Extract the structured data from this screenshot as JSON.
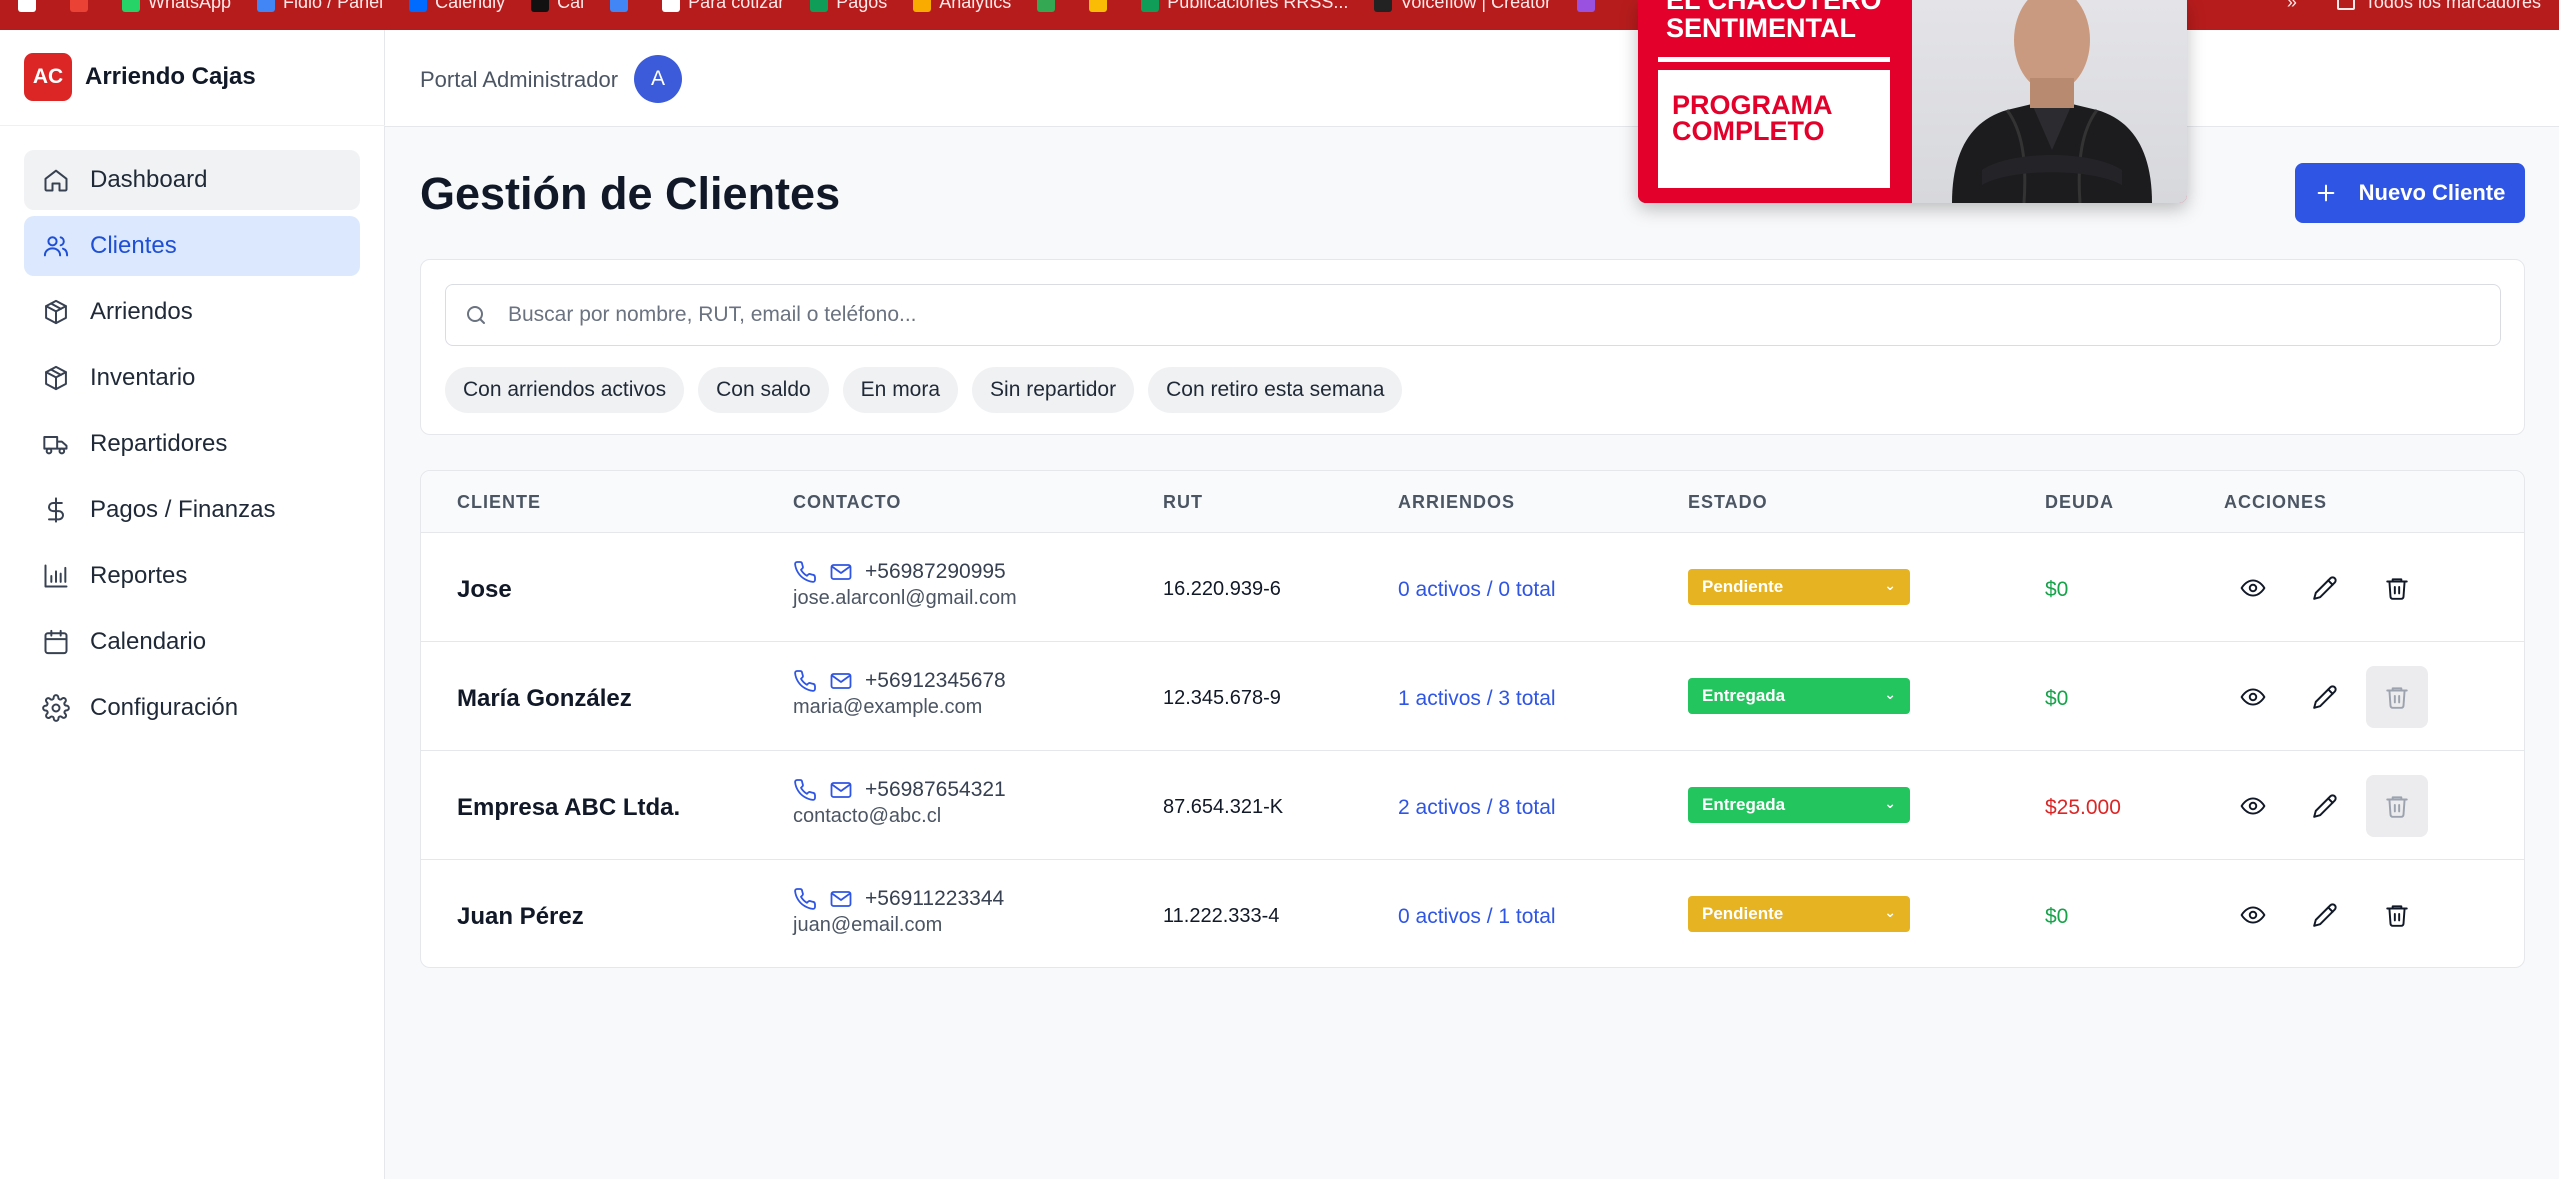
{
  "bookmarks": {
    "items": [
      {
        "label": "",
        "color": "#ffffff"
      },
      {
        "label": "",
        "color": "#ea4335"
      },
      {
        "label": "WhatsApp",
        "color": "#25d366"
      },
      {
        "label": "Fidio / Panel",
        "color": "#4285f4"
      },
      {
        "label": "Calendly",
        "color": "#006bff"
      },
      {
        "label": "Cal",
        "color": "#111111"
      },
      {
        "label": "",
        "color": "#4285f4"
      },
      {
        "label": "Para cotizar",
        "color": "#ffffff"
      },
      {
        "label": "Pagos",
        "color": "#0f9d58"
      },
      {
        "label": "Analytics",
        "color": "#f9ab00"
      },
      {
        "label": "",
        "color": "#34a853"
      },
      {
        "label": "",
        "color": "#fbbc05"
      },
      {
        "label": "Publicaciones RRSS...",
        "color": "#0f9d58"
      },
      {
        "label": "Voiceflow | Creator",
        "color": "#222222"
      },
      {
        "label": "",
        "color": "#9b51e0"
      }
    ],
    "overflow": "»",
    "all_bookmarks": "Todos los marcadores"
  },
  "brand": {
    "logo": "AC",
    "name": "Arriendo Cajas"
  },
  "nav": [
    {
      "label": "Dashboard",
      "icon": "home-icon",
      "state": "hover"
    },
    {
      "label": "Clientes",
      "icon": "users-icon",
      "state": "active"
    },
    {
      "label": "Arriendos",
      "icon": "box-icon",
      "state": ""
    },
    {
      "label": "Inventario",
      "icon": "box-icon",
      "state": ""
    },
    {
      "label": "Repartidores",
      "icon": "truck-icon",
      "state": ""
    },
    {
      "label": "Pagos / Finanzas",
      "icon": "dollar-icon",
      "state": ""
    },
    {
      "label": "Reportes",
      "icon": "bar-chart-icon",
      "state": ""
    },
    {
      "label": "Calendario",
      "icon": "calendar-icon",
      "state": ""
    },
    {
      "label": "Configuración",
      "icon": "gear-icon",
      "state": ""
    }
  ],
  "header": {
    "portal": "Portal Administrador",
    "avatar": "A"
  },
  "page": {
    "title": "Gestión de Clientes",
    "new_button": "Nuevo Cliente"
  },
  "search": {
    "placeholder": "Buscar por nombre, RUT, email o teléfono..."
  },
  "filters": [
    "Con arriendos activos",
    "Con saldo",
    "En mora",
    "Sin repartidor",
    "Con retiro esta semana"
  ],
  "table": {
    "headers": [
      "CLIENTE",
      "CONTACTO",
      "RUT",
      "ARRIENDOS",
      "ESTADO",
      "DEUDA",
      "ACCIONES"
    ],
    "rows": [
      {
        "name": "Jose",
        "phone": "+56987290995",
        "email": "jose.alarconl@gmail.com",
        "rut": "16.220.939-6",
        "arriendos": "0 activos / 0 total",
        "estado": "Pendiente",
        "estado_color": "#e6b322",
        "deuda": "$0",
        "deuda_color": "#16a34a"
      },
      {
        "name": "María González",
        "phone": "+56912345678",
        "email": "maria@example.com",
        "rut": "12.345.678-9",
        "arriendos": "1 activos / 3 total",
        "estado": "Entregada",
        "estado_color": "#22c55e",
        "deuda": "$0",
        "deuda_color": "#16a34a"
      },
      {
        "name": "Empresa ABC Ltda.",
        "phone": "+56987654321",
        "email": "contacto@abc.cl",
        "rut": "87.654.321-K",
        "arriendos": "2 activos / 8 total",
        "estado": "Entregada",
        "estado_color": "#22c55e",
        "deuda": "$25.000",
        "deuda_color": "#dc2626"
      },
      {
        "name": "Juan Pérez",
        "phone": "+56911223344",
        "email": "juan@email.com",
        "rut": "11.222.333-4",
        "arriendos": "0 activos / 1 total",
        "estado": "Pendiente",
        "estado_color": "#e6b322",
        "deuda": "$0",
        "deuda_color": "#16a34a"
      }
    ]
  },
  "promo": {
    "line1": "EL CHACOTERO",
    "line2": "SENTIMENTAL",
    "line3": "PROGRAMA",
    "line4": "COMPLETO"
  }
}
